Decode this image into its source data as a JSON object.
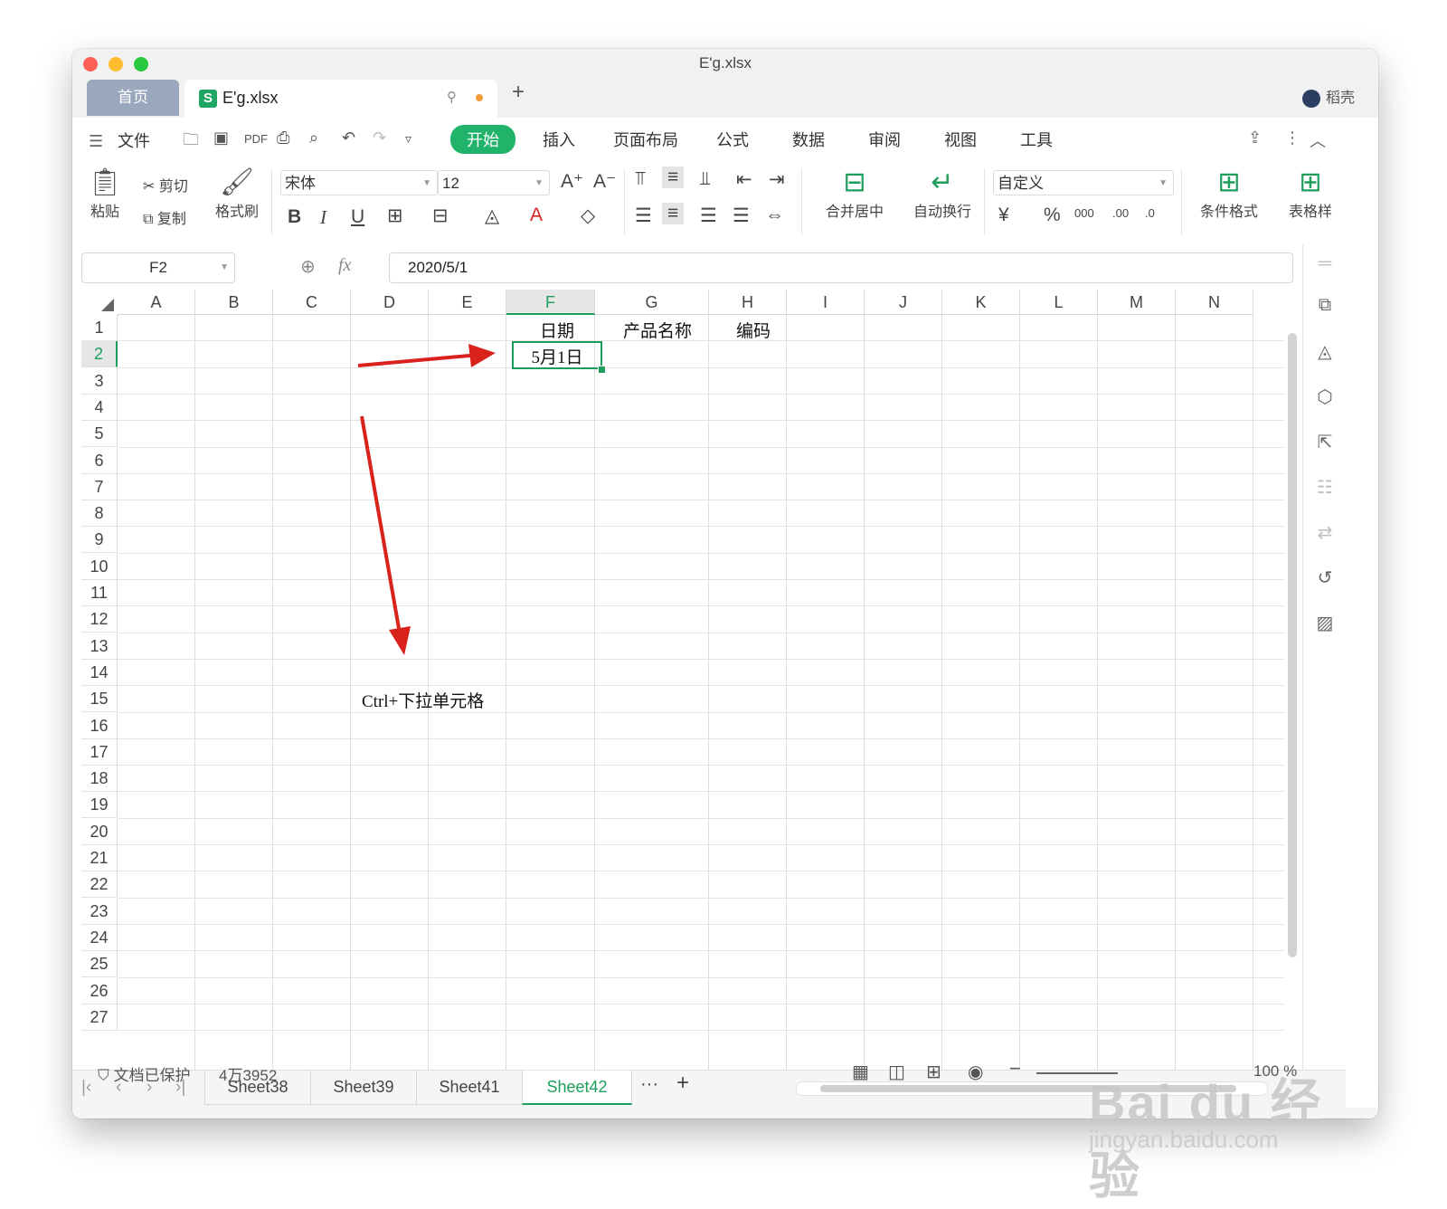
{
  "window": {
    "title": "E'g.xlsx"
  },
  "tabs": {
    "home": "首页",
    "file": "E'g.xlsx",
    "add": "+"
  },
  "user": {
    "name": "稻壳"
  },
  "menu": {
    "file": "文件",
    "tabs": [
      "开始",
      "插入",
      "页面布局",
      "公式",
      "数据",
      "审阅",
      "视图",
      "工具"
    ],
    "active": "开始"
  },
  "ribbon": {
    "paste": "粘贴",
    "cut": "剪切",
    "copy": "复制",
    "format_painter": "格式刷",
    "font_name": "宋体",
    "font_size": "12",
    "merge_center": "合并居中",
    "wrap_text": "自动换行",
    "number_format": "自定义",
    "conditional_format": "条件格式",
    "table_style": "表格样"
  },
  "formula_bar": {
    "name_box": "F2",
    "fx": "fx",
    "value": "2020/5/1"
  },
  "grid": {
    "columns": [
      "A",
      "B",
      "C",
      "D",
      "E",
      "F",
      "G",
      "H",
      "I",
      "J",
      "K",
      "L",
      "M",
      "N"
    ],
    "rows": [
      "1",
      "2",
      "3",
      "4",
      "5",
      "6",
      "7",
      "8",
      "9",
      "10",
      "11",
      "12",
      "13",
      "14",
      "15",
      "16",
      "17",
      "18",
      "19",
      "20",
      "21",
      "22",
      "23",
      "24",
      "25",
      "26",
      "27"
    ],
    "selected_column": "F",
    "selected_row": "2",
    "cells": {
      "F1": "日期",
      "G1": "产品名称",
      "H1": "编码",
      "F2": "5月1日"
    },
    "annotation": "Ctrl+下拉单元格",
    "arrow_color": "#d9221c",
    "selection_color": "#1d9e5a"
  },
  "sheets": {
    "tabs": [
      "Sheet38",
      "Sheet39",
      "Sheet41",
      "Sheet42"
    ],
    "active": "Sheet42",
    "more": "···",
    "add": "+"
  },
  "status": {
    "protected": "文档已保护",
    "count": "4万3952",
    "zoom": "100 %"
  },
  "watermark": {
    "brand": "Bai du 经验",
    "url": "jingyan.baidu.com"
  }
}
